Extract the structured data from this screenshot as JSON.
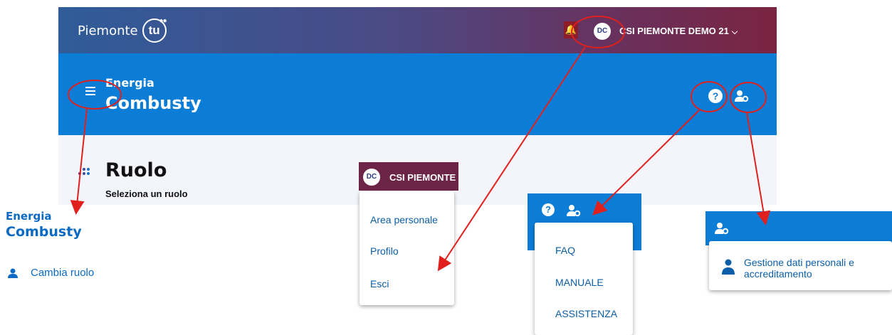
{
  "header": {
    "brand_text": "Piemonte",
    "brand_mark": "tu",
    "user_initials": "DC",
    "user_name": "CSI PIEMONTE DEMO 21",
    "user_chevron": "chevron-down-icon",
    "bell_icon": "bell-icon",
    "gradient_colors": [
      "#2f5c99",
      "#7a2440"
    ]
  },
  "app_bar": {
    "category": "Energia",
    "app_name": "Combusty",
    "menu_icon": "hamburger-icon",
    "help_icon": "question-circle-icon",
    "profile_settings_icon": "user-cog-icon",
    "color": "#0b7dd7"
  },
  "page": {
    "title": "Ruolo",
    "subtitle": "Seleziona un ruolo"
  },
  "side_menu": {
    "category": "Energia",
    "app_name": "Combusty",
    "items": [
      {
        "label": "Cambia ruolo",
        "icon": "user-icon"
      }
    ]
  },
  "user_menu": {
    "initials": "DC",
    "name": "CSI PIEMONTE",
    "items": [
      {
        "label": "Area personale"
      },
      {
        "label": "Profilo"
      },
      {
        "label": "Esci"
      }
    ]
  },
  "help_menu": {
    "items": [
      {
        "label": "FAQ"
      },
      {
        "label": "MANUALE"
      },
      {
        "label": "ASSISTENZA"
      }
    ]
  },
  "profile_menu": {
    "items": [
      {
        "label": "Gestione dati personali e accreditamento",
        "icon": "user-icon"
      }
    ]
  },
  "annotation_color": "#e0201c"
}
